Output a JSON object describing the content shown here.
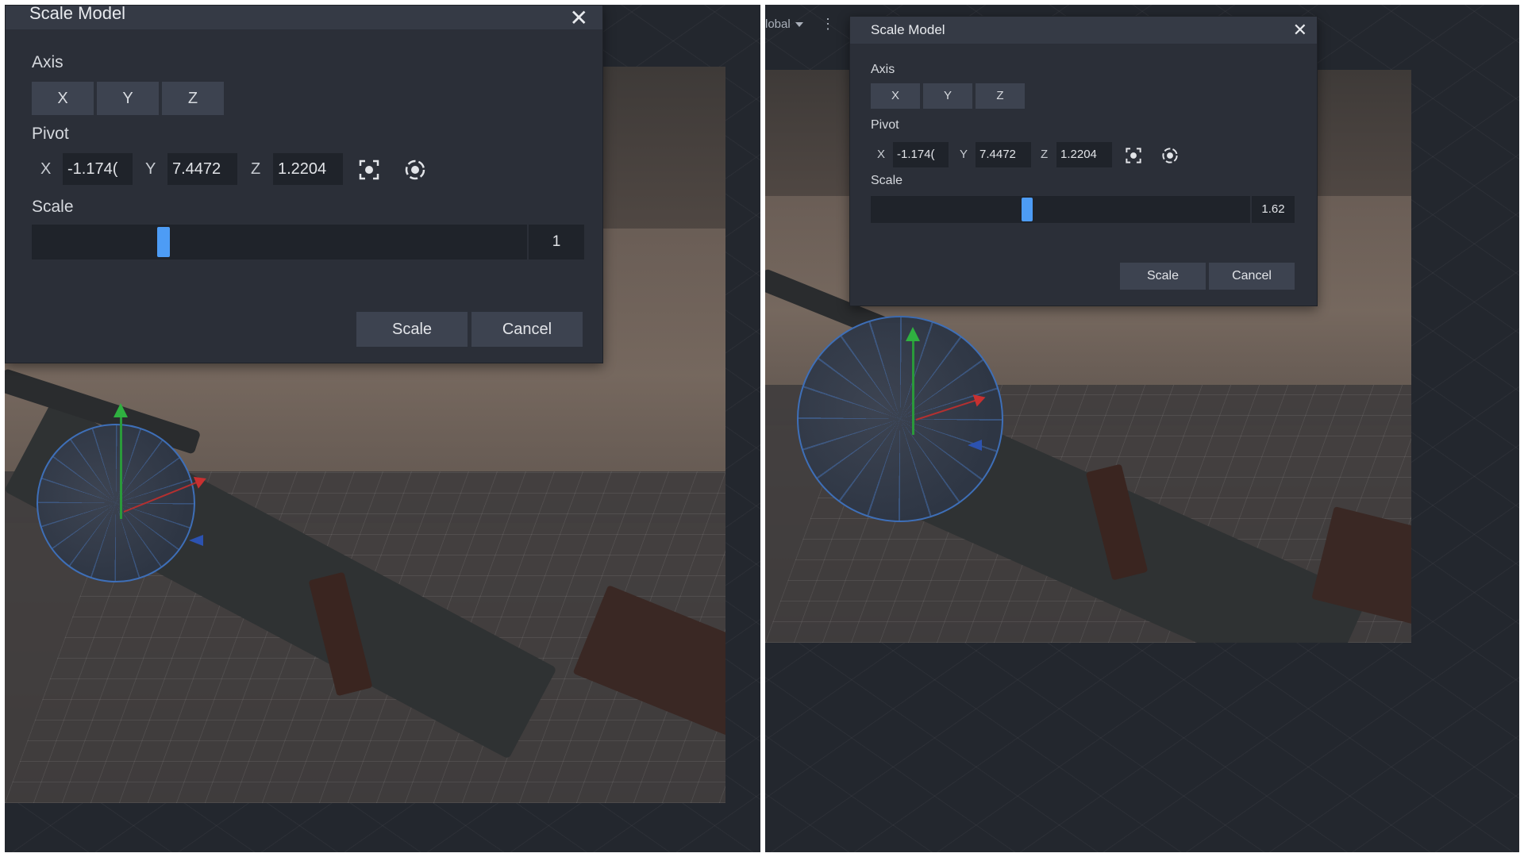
{
  "left": {
    "dialog": {
      "title": "Scale Model",
      "close_glyph": "✕",
      "axis_label": "Axis",
      "axis_buttons": [
        "X",
        "Y",
        "Z"
      ],
      "pivot_label": "Pivot",
      "pivot": [
        {
          "label": "X",
          "value": "-1.174("
        },
        {
          "label": "Y",
          "value": "7.4472"
        },
        {
          "label": "Z",
          "value": "1.2204"
        }
      ],
      "pivot_icons": [
        "focus-target-icon",
        "center-pivot-icon"
      ],
      "scale_label": "Scale",
      "scale_value": "1",
      "scale_slider_fraction": 0.26,
      "buttons": {
        "scale": "Scale",
        "cancel": "Cancel"
      }
    }
  },
  "right": {
    "topbar": {
      "fragment": "lobal",
      "menu_glyph": "⋮"
    },
    "dialog": {
      "title": "Scale Model",
      "close_glyph": "✕",
      "axis_label": "Axis",
      "axis_buttons": [
        "X",
        "Y",
        "Z"
      ],
      "pivot_label": "Pivot",
      "pivot": [
        {
          "label": "X",
          "value": "-1.174("
        },
        {
          "label": "Y",
          "value": "7.4472"
        },
        {
          "label": "Z",
          "value": "1.2204"
        }
      ],
      "pivot_icons": [
        "focus-target-icon",
        "center-pivot-icon"
      ],
      "scale_label": "Scale",
      "scale_value": "1.62",
      "scale_slider_fraction": 0.41,
      "buttons": {
        "scale": "Scale",
        "cancel": "Cancel"
      }
    }
  },
  "colors": {
    "dialog_bg": "#2b2f38",
    "header_bg": "#353a45",
    "button_bg": "#3d4350",
    "input_bg": "#1f232a",
    "accent": "#4d9cf5"
  }
}
